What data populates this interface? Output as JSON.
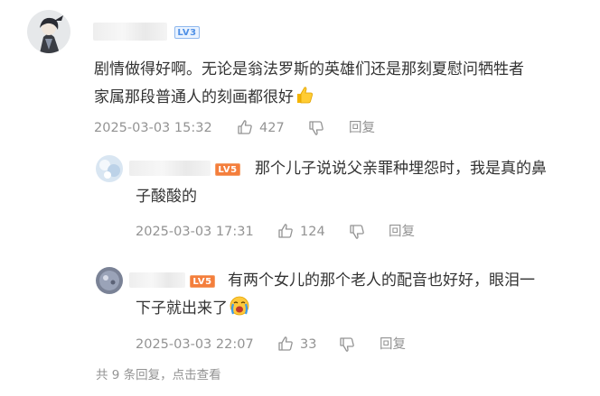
{
  "comment": {
    "level_badge": "LV3",
    "text_line1": "剧情做得好啊。无论是翁法罗斯的英雄们还是那刻夏慰问牺牲者",
    "text_line2": "家属那段普通人的刻画都很好",
    "emoji": "thumbs-up",
    "timestamp": "2025-03-03 15:32",
    "likes": "427",
    "reply_label": "回复"
  },
  "replies": [
    {
      "level_badge": "LV5",
      "text_line1": "那个儿子说说父亲罪种埋怨时，我是真的鼻",
      "text_line2": "子酸酸的",
      "timestamp": "2025-03-03 17:31",
      "likes": "124",
      "reply_label": "回复"
    },
    {
      "level_badge": "LV5",
      "text_line1": "有两个女儿的那个老人的配音也好好，眼泪一",
      "text_line2": "下子就出来了",
      "emoji": "crying-face",
      "timestamp": "2025-03-03 22:07",
      "likes": "33",
      "reply_label": "回复"
    }
  ],
  "footer": {
    "more_replies": "共 9 条回复，点击查看"
  },
  "colors": {
    "text": "#333333",
    "meta": "#939393",
    "badge_blue": "#4f90e6",
    "badge_orange": "#f47e3c"
  }
}
